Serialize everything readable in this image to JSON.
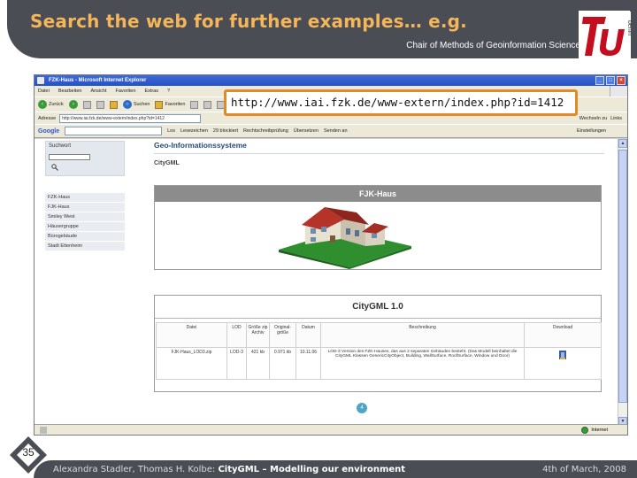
{
  "slide": {
    "title": "Search the web for further examples… e.g.",
    "subtitle": "Chair of Methods of Geoinformation Science",
    "logo_text": "berlin",
    "page_number": "35",
    "footer_authors": "Alexandra Stadler, Thomas H. Kolbe:",
    "footer_topic": "CityGML – Modelling our environment",
    "footer_date": "4th of March, 2008"
  },
  "callout": {
    "url": "http://www.iai.fzk.de/www-extern/index.php?id=1412"
  },
  "browser": {
    "window_title": "FZK-Haus - Microsoft Internet Explorer",
    "menu": [
      "Datei",
      "Bearbeiten",
      "Ansicht",
      "Favoriten",
      "Extras",
      "?"
    ],
    "toolbar": {
      "back": "Zurück",
      "search": "Suchen",
      "favorites": "Favoriten"
    },
    "address_label": "Adresse",
    "address_value": "http://www.iai.fzk.de/www-extern/index.php?id=1412",
    "address_right": [
      "Wechseln zu",
      "Links"
    ],
    "google": {
      "logo": "Google",
      "items": [
        "Los",
        "Lesezeichen",
        "29 blockiert",
        "Rechtschreibprüfung",
        "Übersetzen",
        "Senden an"
      ],
      "settings": "Einstellungen"
    },
    "status_zone": "Internet"
  },
  "page": {
    "search_label": "Suchwort",
    "nav_items": [
      "FZK-Haus",
      "FJK-Haus",
      "Smiley West",
      "Häusergruppe",
      "Bürogebäude",
      "Stadt Ettenheim"
    ],
    "site_title": "Geo-Informationssysteme",
    "section_label": "CityGML",
    "house_panel_title": "FJK-Haus",
    "gml_panel_title": "CityGML 1.0",
    "table": {
      "headers": [
        "Datei",
        "LOD",
        "Größe zip Archiv",
        "Original-größe",
        "Datum",
        "Beschreibung",
        "Download"
      ],
      "rows": [
        {
          "file": "FJK-Haus_LOD3.zip",
          "lod": "LOD-3",
          "zip_size": "421 kb",
          "orig_size": "0.971 kb",
          "date": "10.11.06",
          "description": "LOD-3 Version des FZK-Hauses, das aus 2 separaten Gebäuden besteht. (Das Modell beinhaltet die CityGML Klassen GenericCityObject, Building, WallSurface, RoofSurface, Window und Door)"
        }
      ]
    },
    "pager": "4"
  },
  "colors": {
    "header_band": "#4b4d55",
    "title": "#f5b65a",
    "callout_border": "#e08a2a",
    "site_title": "#234b7a"
  }
}
